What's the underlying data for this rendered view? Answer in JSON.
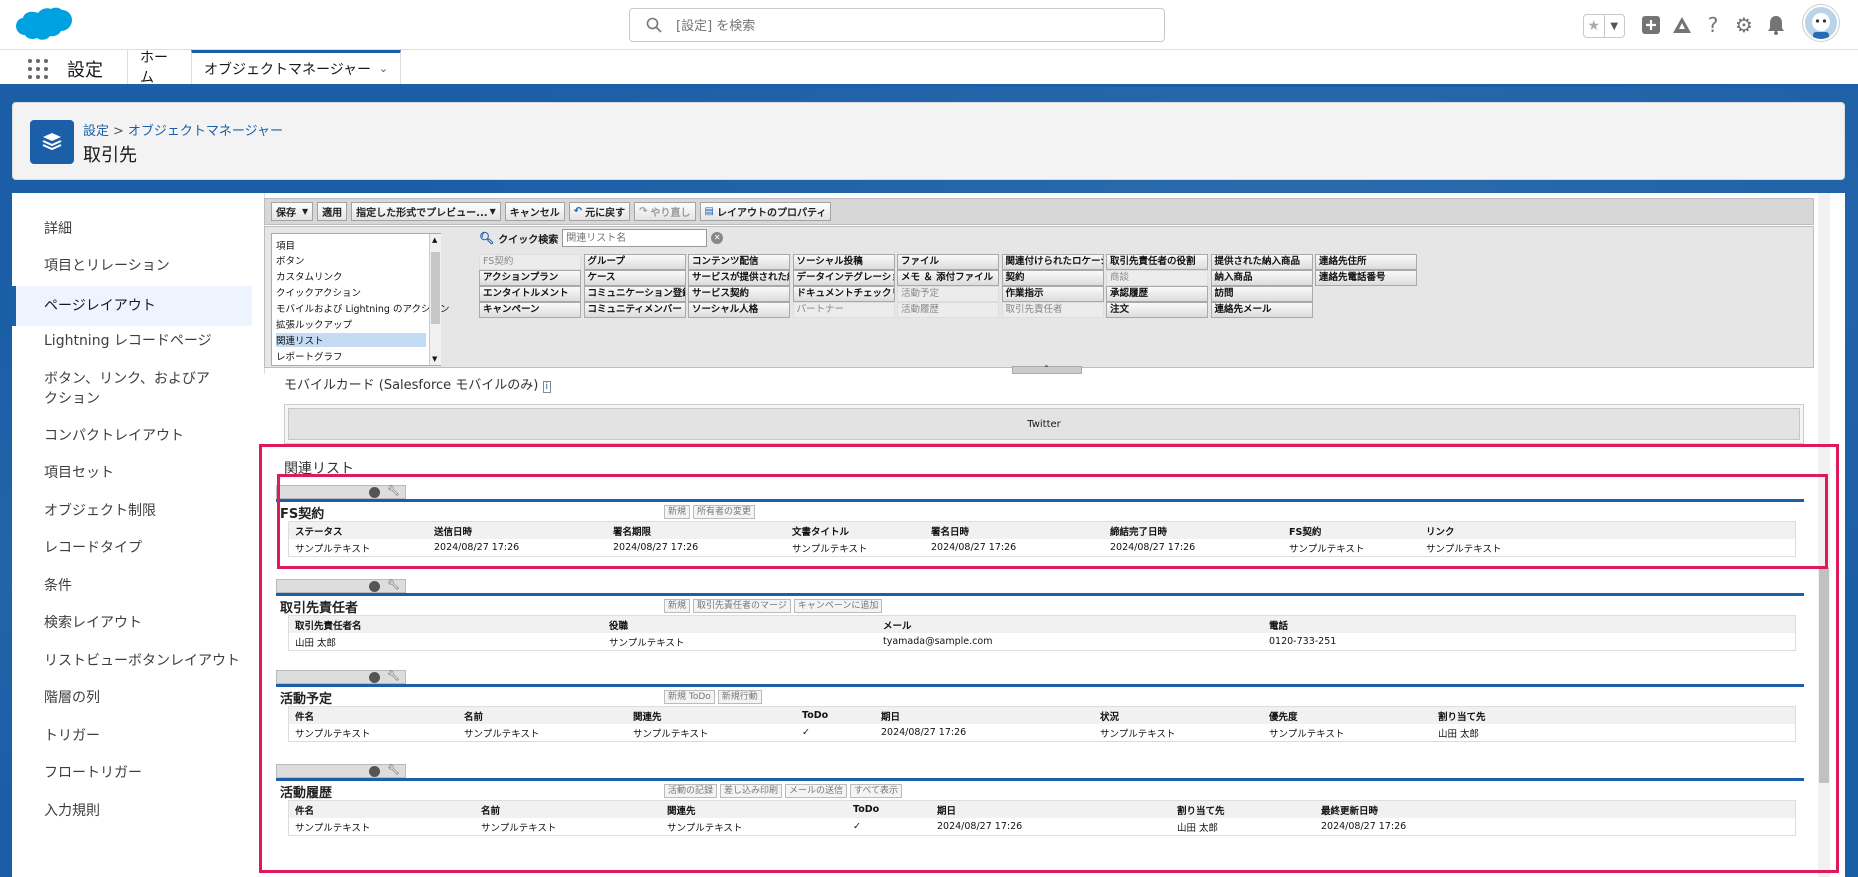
{
  "topbar": {
    "search_placeholder": "[設定] を検索",
    "icons": [
      "star-icon",
      "chevron-down-icon",
      "plus-icon",
      "trailhead-icon",
      "help-icon",
      "gear-icon",
      "bell-icon",
      "avatar-icon"
    ]
  },
  "nav": {
    "app_name": "設定",
    "tabs": [
      {
        "label": "ホーム"
      },
      {
        "label": "オブジェクトマネージャー"
      }
    ]
  },
  "header": {
    "breadcrumb": [
      "設定",
      "オブジェクトマネージャー"
    ],
    "breadcrumb_sep": ">",
    "title": "取引先"
  },
  "sidebar": {
    "items": [
      {
        "label": "詳細"
      },
      {
        "label": "項目とリレーション"
      },
      {
        "label": "ページレイアウト",
        "active": true
      },
      {
        "label": "Lightning レコードページ"
      },
      {
        "label": "ボタン、リンク、およびアクション"
      },
      {
        "label": "コンパクトレイアウト"
      },
      {
        "label": "項目セット"
      },
      {
        "label": "オブジェクト制限"
      },
      {
        "label": "レコードタイプ"
      },
      {
        "label": "条件"
      },
      {
        "label": "検索レイアウト"
      },
      {
        "label": "リストビューボタンレイアウト"
      },
      {
        "label": "階層の列"
      },
      {
        "label": "トリガー"
      },
      {
        "label": "フロートリガー"
      },
      {
        "label": "入力規則"
      }
    ]
  },
  "toolbar": {
    "save": "保存",
    "apply": "適用",
    "preview": "指定した形式でプレビュー...",
    "cancel": "キャンセル",
    "undo": "元に戻す",
    "redo": "やり直し",
    "layout_props": "レイアウトのプロパティ"
  },
  "palette": {
    "categories": [
      "項目",
      "ボタン",
      "カスタムリンク",
      "クイックアクション",
      "モバイルおよび Lightning のアクション",
      "拡張ルックアップ",
      "関連リスト",
      "レポートグラフ"
    ],
    "selected_category": "関連リスト",
    "quick_search_label": "クイック検索",
    "quick_search_placeholder": "関連リスト名",
    "items": [
      [
        "FS契約",
        "グループ",
        "コンテンツ配信",
        "ソーシャル投稿",
        "ファイル",
        "関連付けられたロケーション",
        "取引先責任者の役割",
        "提供された納入商品",
        "連絡先住所"
      ],
      [
        "アクションプラン",
        "ケース",
        "サービスが提供された納入",
        "データインテグレーションルール",
        "メモ ＆ 添付ファイル",
        "契約",
        "商談",
        "納入商品",
        "連絡先電話番号"
      ],
      [
        "エンタイトルメント",
        "コミュニケーション登録の同意",
        "サービス契約",
        "ドキュメントチェックリスト項目",
        "活動予定",
        "作業指示",
        "承認履歴",
        "訪問"
      ],
      [
        "キャンペーン",
        "コミュニティメンバー",
        "ソーシャル人格",
        "パートナー",
        "活動履歴",
        "取引先責任者",
        "注文",
        "連絡先メール"
      ]
    ],
    "used": [
      "FS契約",
      "商談",
      "活動予定",
      "パートナー",
      "活動履歴",
      "取引先責任者"
    ]
  },
  "layout": {
    "mobile_card_title": "モバイルカード (Salesforce モバイルのみ)",
    "twitter": "Twitter",
    "related_lists_heading": "関連リスト",
    "lists": [
      {
        "title": "FS契約",
        "buttons": [
          "新規",
          "所有者の変更"
        ],
        "columns": [
          "ステータス",
          "送信日時",
          "署名期限",
          "文書タイトル",
          "署名日時",
          "締結完了日時",
          "FS契約",
          "リンク"
        ],
        "row": [
          "サンプルテキスト",
          "2024/08/27 17:26",
          "2024/08/27 17:26",
          "サンプルテキスト",
          "2024/08/27 17:26",
          "2024/08/27 17:26",
          "サンプルテキスト",
          "サンプルテキスト"
        ]
      },
      {
        "title": "取引先責任者",
        "buttons": [
          "新規",
          "取引先責任者のマージ",
          "キャンペーンに追加"
        ],
        "columns": [
          "取引先責任者名",
          "役職",
          "メール",
          "電話"
        ],
        "row": [
          "山田 太郎",
          "サンプルテキスト",
          "tyamada@sample.com",
          "0120-733-251"
        ]
      },
      {
        "title": "活動予定",
        "buttons": [
          "新規 ToDo",
          "新規行動"
        ],
        "columns": [
          "件名",
          "名前",
          "関連先",
          "ToDo",
          "期日",
          "状況",
          "優先度",
          "割り当て先"
        ],
        "row": [
          "サンプルテキスト",
          "サンプルテキスト",
          "サンプルテキスト",
          "✓",
          "2024/08/27 17:26",
          "サンプルテキスト",
          "サンプルテキスト",
          "山田 太郎"
        ]
      },
      {
        "title": "活動履歴",
        "buttons": [
          "活動の記録",
          "差し込み印刷",
          "メールの送信",
          "すべて表示"
        ],
        "columns": [
          "件名",
          "名前",
          "関連先",
          "ToDo",
          "期日",
          "割り当て先",
          "最終更新日時"
        ],
        "row": [
          "サンプルテキスト",
          "サンプルテキスト",
          "サンプルテキスト",
          "✓",
          "2024/08/27 17:26",
          "山田 太郎",
          "2024/08/27 17:26"
        ]
      }
    ]
  },
  "colors": {
    "brand": "#1b5fa8",
    "highlight": "#e0185e"
  }
}
